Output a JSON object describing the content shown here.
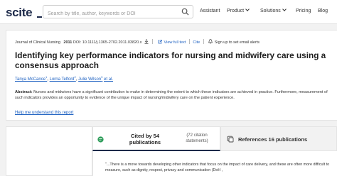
{
  "header": {
    "logo": "scite",
    "search_placeholder": "Search by title, author, keywords or DOI",
    "nav": {
      "assistant": "Assistant",
      "product": "Product",
      "solutions": "Solutions",
      "pricing": "Pricing",
      "blog": "Blog"
    }
  },
  "article": {
    "journal": "Journal of Clinical Nursing",
    "year": "2011",
    "doi": "DOI: 10.1111/j.1365-2702.2011.03820.x",
    "view_full_text": "View full text",
    "cite": "Cite",
    "alert_label": "Sign up to set email alerts",
    "title": "Identifying key performance indicators for nursing and midwifery care using a consensus approach",
    "authors": {
      "a1": "Tanya McCance",
      "a1_sup": "1",
      "a2": "Lorna Telford",
      "a2_sup": "2",
      "a3": "Julie Wilson",
      "a3_sup": "3",
      "etal": "et al."
    },
    "abstract_label": "Abstract:",
    "abstract_text": " Nurses and midwives have a significant contribution to make in determining the extent to which these indicators are achieved in practice. Furthermore, measurement of such indicators provides an opportunity to evidence of the unique impact of nursing/midwifery care on the patient experience.",
    "help_link": "Help me understand this report"
  },
  "tabs": {
    "cited_by": "Cited by 54 publications",
    "citation_statements": "(72 citation statements)",
    "references": "References 16 publications"
  },
  "quote": {
    "text": "\"...There is a move towards developing other indicators that focus on the impact of care delivery, and these are often more difficult to measure, such as dignity, respect, privacy and communication (DoH ,"
  },
  "colors": {
    "brand_navy": "#1d2a4a",
    "link_blue": "#1b5fc0",
    "cite_green": "#2e9d5a"
  }
}
